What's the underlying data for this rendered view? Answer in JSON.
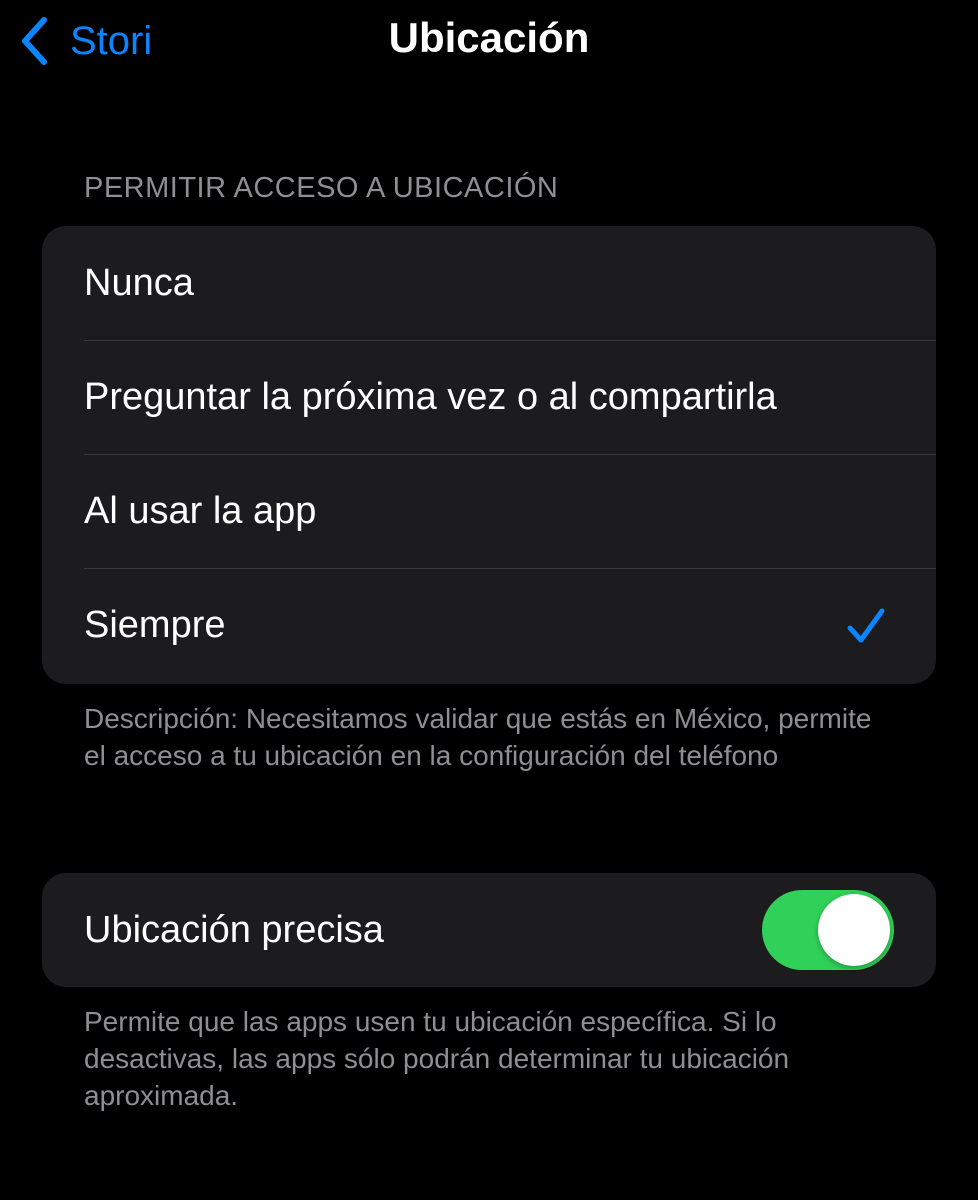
{
  "nav": {
    "back_label": "Stori",
    "back_icon": "chevron-left-icon",
    "title": "Ubicación"
  },
  "access": {
    "header": "PERMITIR ACCESO A UBICACIÓN",
    "options": [
      {
        "label": "Nunca",
        "selected": false
      },
      {
        "label": "Preguntar la próxima vez o al compartirla",
        "selected": false
      },
      {
        "label": "Al usar la app",
        "selected": false
      },
      {
        "label": "Siempre",
        "selected": true
      }
    ],
    "footer": "Descripción: Necesitamos validar que estás en México, permite el acceso a tu ubicación en la configuración del teléfono"
  },
  "precise": {
    "label": "Ubicación precisa",
    "enabled": true,
    "footer": "Permite que las apps usen tu ubicación específica. Si lo desactivas, las apps sólo podrán determinar tu ubicación aproximada."
  },
  "colors": {
    "accent": "#0a84ff",
    "toggle_on": "#30d158",
    "group_bg": "#1c1c1e",
    "secondary_text": "#8e8e93"
  }
}
